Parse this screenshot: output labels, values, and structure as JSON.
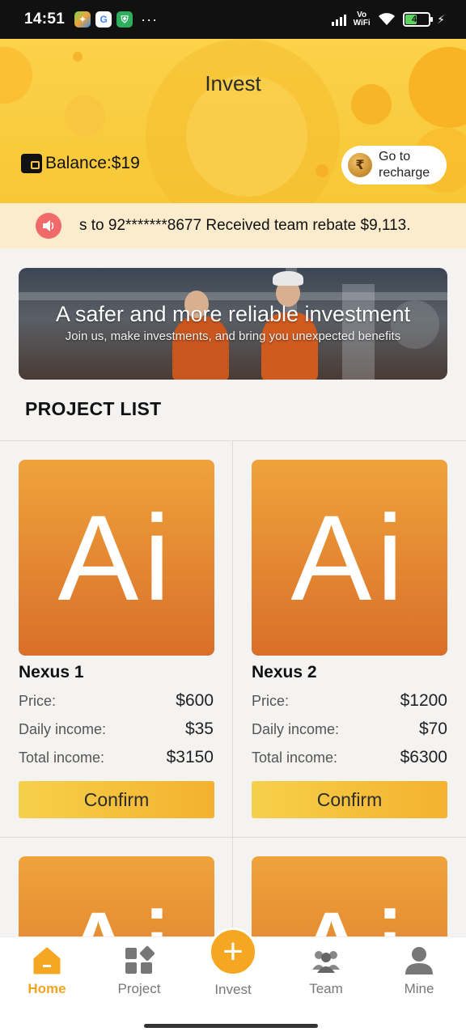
{
  "status_bar": {
    "time": "14:51",
    "app_icons": [
      "app-store-icon",
      "google-icon",
      "shield-app-icon"
    ],
    "overflow": "···",
    "network": "Vo WiFi",
    "battery": "47"
  },
  "header": {
    "title": "Invest",
    "balance_label": "Balance:$19",
    "recharge_label": "Go to recharge",
    "coin_symbol": "₹",
    "accent_color": "#f7c736"
  },
  "marquee": {
    "text": "s to 92*******8677 Received team rebate $9,113."
  },
  "banner": {
    "title": "A safer and more reliable investment",
    "subtitle": "Join us, make investments, and bring you unexpected benefits"
  },
  "section_title": "PROJECT LIST",
  "projects": [
    {
      "thumb": "Ai",
      "name": "Nexus 1",
      "price_label": "Price:",
      "price": "$600",
      "daily_label": "Daily income:",
      "daily": "$35",
      "total_label": "Total income:",
      "total": "$3150",
      "button": "Confirm"
    },
    {
      "thumb": "Ai",
      "name": "Nexus 2",
      "price_label": "Price:",
      "price": "$1200",
      "daily_label": "Daily income:",
      "daily": "$70",
      "total_label": "Total income:",
      "total": "$6300",
      "button": "Confirm"
    },
    {
      "thumb": "Ai"
    },
    {
      "thumb": "Ai"
    }
  ],
  "bottom_nav": {
    "items": [
      {
        "label": "Home",
        "icon": "home-icon",
        "active": true
      },
      {
        "label": "Project",
        "icon": "grid-icon",
        "active": false
      },
      {
        "label": "Invest",
        "icon": "plus-icon",
        "active": false
      },
      {
        "label": "Team",
        "icon": "team-icon",
        "active": false
      },
      {
        "label": "Mine",
        "icon": "user-icon",
        "active": false
      }
    ],
    "invest_symbol": "+",
    "active_color": "#f3a322"
  }
}
